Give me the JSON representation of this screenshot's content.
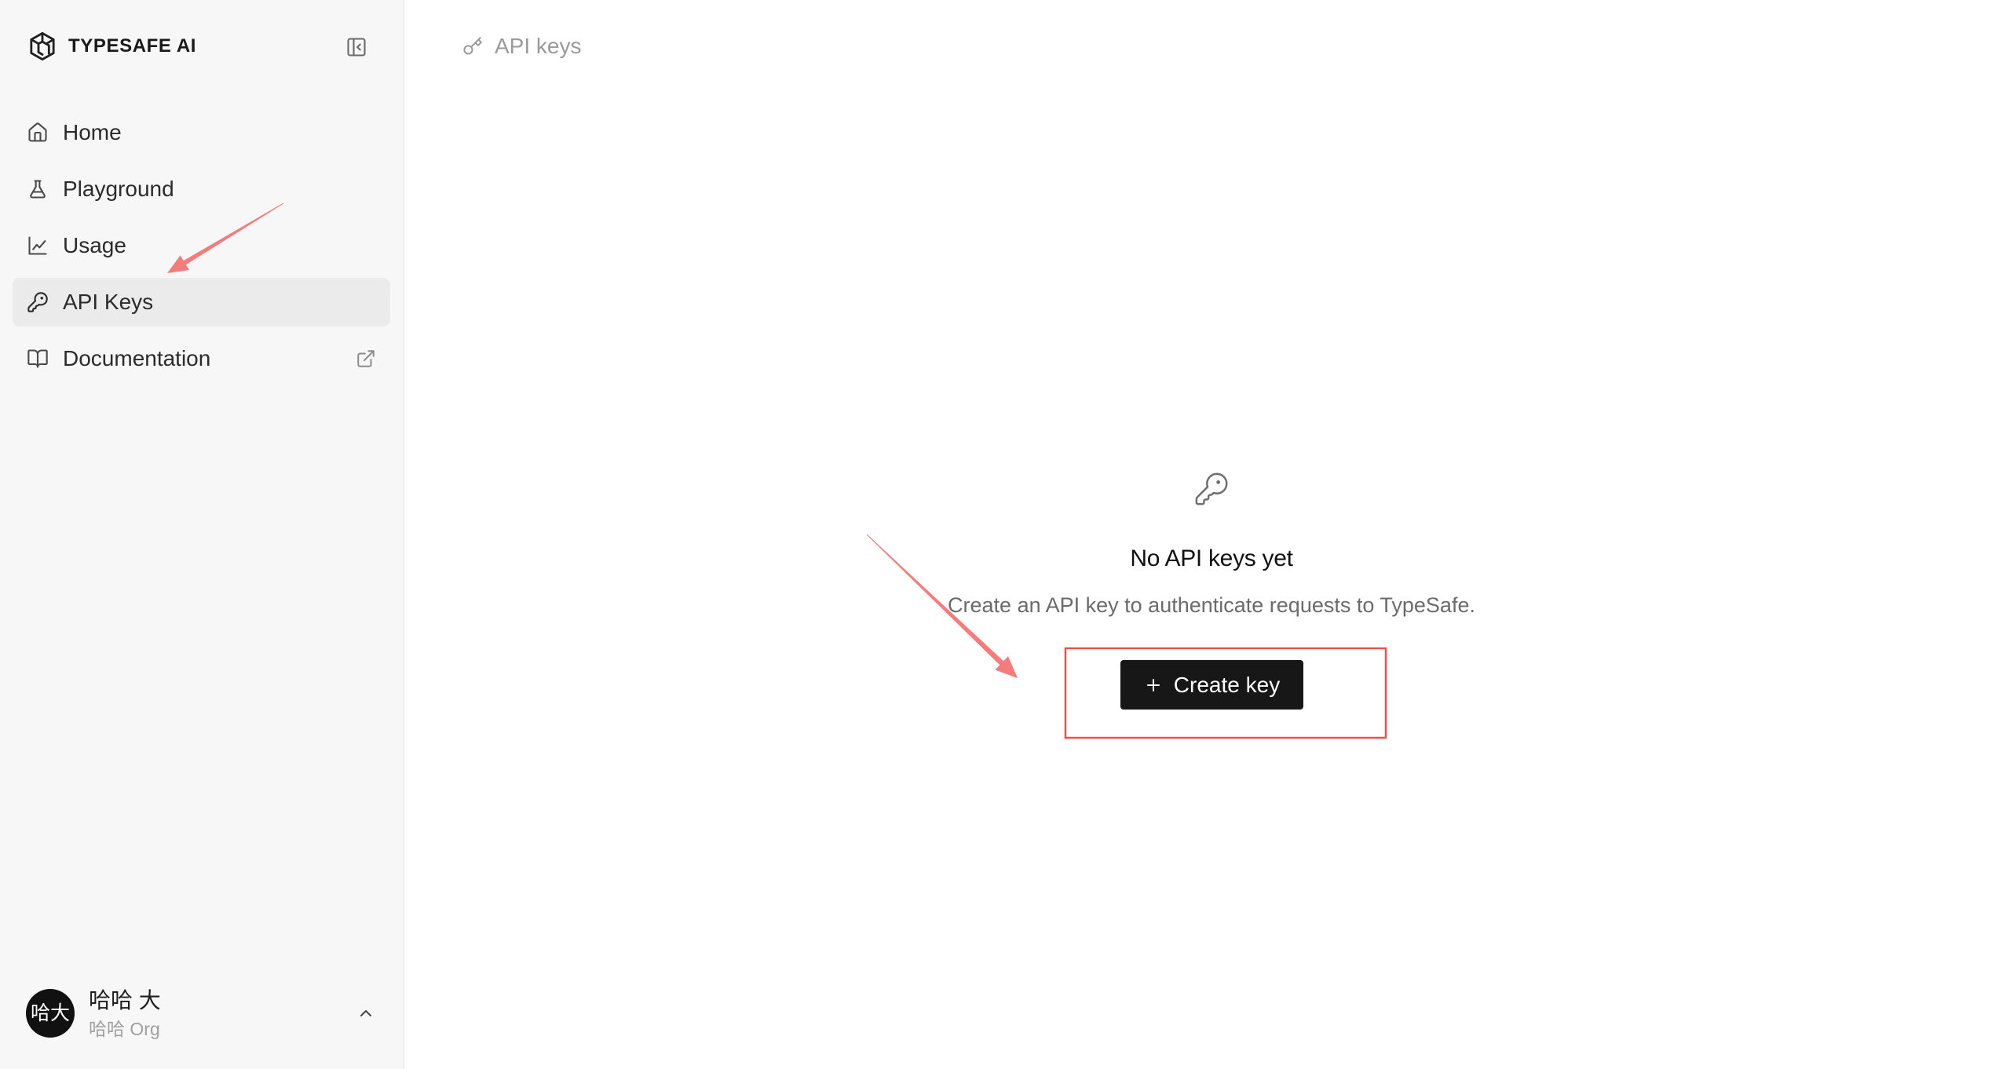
{
  "app": {
    "brand": "TYPESAFE AI",
    "logo_icon": "typesafe-logo-icon"
  },
  "sidebar": {
    "toggle_icon": "sidebar-collapse-icon",
    "items": [
      {
        "label": "Home",
        "icon": "home-icon",
        "active": false
      },
      {
        "label": "Playground",
        "icon": "flask-icon",
        "active": false
      },
      {
        "label": "Usage",
        "icon": "line-chart-icon",
        "active": false
      },
      {
        "label": "API Keys",
        "icon": "key-icon",
        "active": true
      },
      {
        "label": "Documentation",
        "icon": "book-open-icon",
        "active": false,
        "trailing_icon": "external-link-icon"
      }
    ],
    "user": {
      "avatar_text": "哈大",
      "name": "哈哈 大",
      "org": "哈哈 Org",
      "menu_icon": "chevron-up-icon"
    }
  },
  "breadcrumb": {
    "icon": "key-icon",
    "label": "API keys"
  },
  "empty_state": {
    "icon": "key-icon",
    "title": "No API keys yet",
    "description": "Create an API key to authenticate requests to TypeSafe.",
    "button_label": "Create key",
    "button_icon": "plus-icon"
  },
  "colors": {
    "sidebar_bg": "#f7f7f7",
    "active_item_bg": "#ebebeb",
    "button_bg": "#171717",
    "annotation_arrow": "#f47c7c",
    "annotation_box": "#e8534a"
  }
}
